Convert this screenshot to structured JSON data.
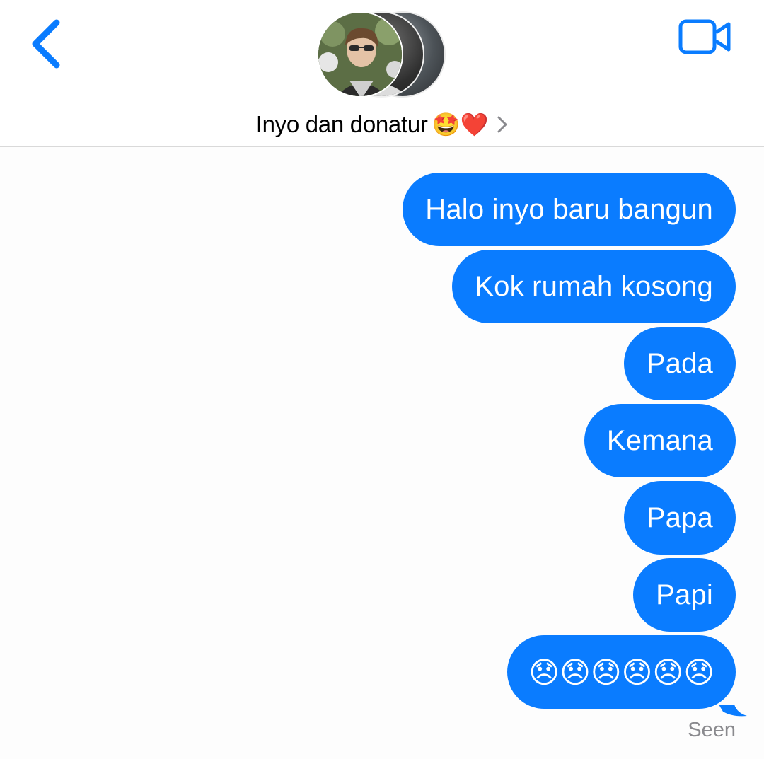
{
  "header": {
    "group_name": "Inyo dan donatur",
    "group_emojis": "🤩❤️"
  },
  "messages": [
    {
      "text": "Halo inyo baru bangun"
    },
    {
      "text": "Kok rumah kosong"
    },
    {
      "text": "Pada"
    },
    {
      "text": "Kemana"
    },
    {
      "text": "Papa"
    },
    {
      "text": "Papi"
    },
    {
      "text": "😞😞😞😞😞😞"
    }
  ],
  "status": {
    "seen_label": "Seen"
  },
  "icons": {
    "back": "chevron-left-icon",
    "video": "video-camera-icon",
    "disclosure": "chevron-right-icon"
  },
  "colors": {
    "accent": "#0a7cff",
    "bubble_text": "#ffffff",
    "seen_text": "#8a8a8e"
  }
}
